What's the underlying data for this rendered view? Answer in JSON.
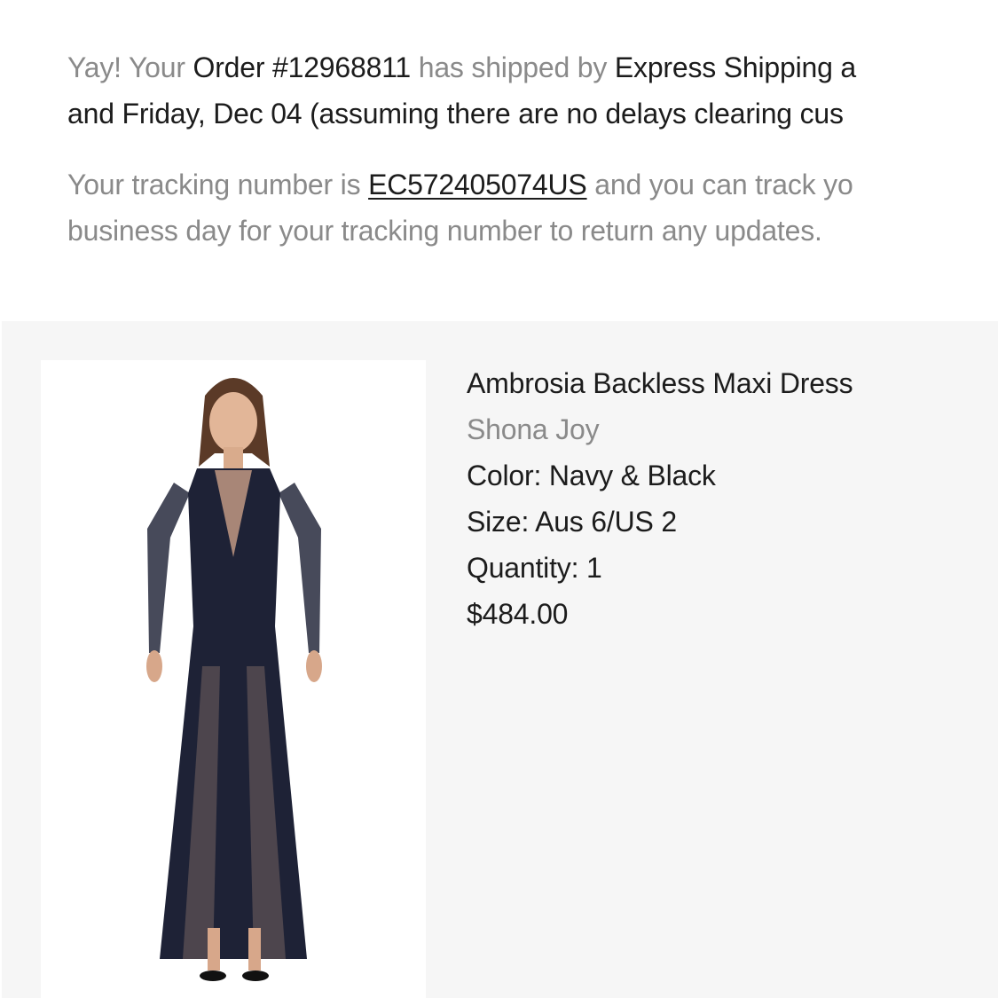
{
  "message": {
    "line1": {
      "prefix": "Yay! Your ",
      "order": "Order #12968811",
      "middle": " has shipped by ",
      "method": "Express Shipping a"
    },
    "line2": "and Friday, Dec 04 (assuming there are no delays clearing cus",
    "tracking": {
      "prefix": "Your tracking number is ",
      "number": "EC572405074US",
      "suffix": " and you can track yo",
      "line2": "business day for your tracking number to return any updates."
    }
  },
  "product": {
    "image_icon": "product-photo-dress",
    "name": "Ambrosia Backless Maxi Dress",
    "brand": "Shona Joy",
    "color": "Color: Navy & Black",
    "size": "Size: Aus 6/US 2",
    "quantity": "Quantity: 1",
    "price": "$484.00"
  },
  "colors": {
    "text_dark": "#1c1c1c",
    "text_muted": "#8a8a8a",
    "card_bg": "#f6f6f6",
    "dress_navy": "#1e2236"
  }
}
